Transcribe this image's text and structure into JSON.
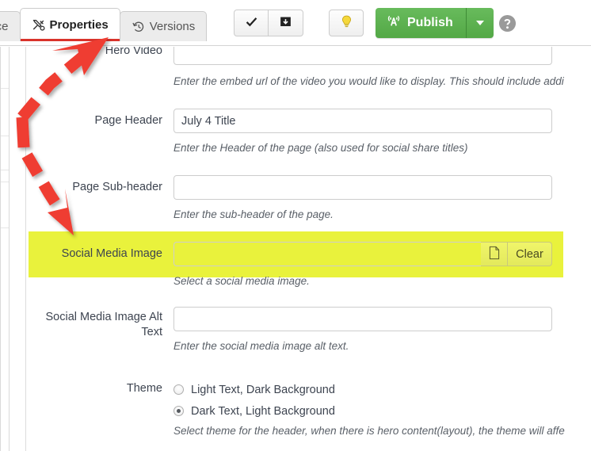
{
  "toolbar": {
    "tabs": [
      {
        "label": "ource",
        "icon": "source-icon",
        "active": false,
        "truncated": true
      },
      {
        "label": "Properties",
        "icon": "tools-icon",
        "active": true
      },
      {
        "label": "Versions",
        "icon": "history-clock-icon",
        "active": false
      }
    ],
    "buttons": [
      {
        "name": "approve-button",
        "icon": "checkmark-icon"
      },
      {
        "name": "save-button",
        "icon": "save-box-down-arrow-icon"
      },
      {
        "name": "tips-button",
        "icon": "lightbulb-icon"
      }
    ],
    "publish_label": "Publish",
    "publish_icon": "broadcast-antenna-icon",
    "publish_color": "#55a847",
    "help_icon": "question-mark-circle-icon"
  },
  "form": {
    "fields": [
      {
        "label": "Hero Video",
        "value": "",
        "hint": "Enter the embed url of the video you would like to display. This should include addi",
        "type": "text",
        "name": "hero-video"
      },
      {
        "label": "Page Header",
        "value": "July 4 Title",
        "hint": "Enter the Header of the page (also used for social share titles)",
        "type": "text",
        "name": "page-header"
      },
      {
        "label": "Page Sub-header",
        "value": "",
        "hint": "Enter the sub-header of the page.",
        "type": "text",
        "name": "page-sub-header"
      },
      {
        "label": "Social Media Image",
        "value": "",
        "hint": "Select a social media image.",
        "type": "picker",
        "name": "social-media-image",
        "highlighted": true,
        "file_icon": "document-page-icon",
        "clear_label": "Clear"
      },
      {
        "label": "Social Media Image Alt Text",
        "value": "",
        "hint": "Enter the social media image alt text.",
        "type": "text",
        "name": "social-media-image-alt-text"
      }
    ],
    "theme": {
      "label": "Theme",
      "options": [
        {
          "label": "Light Text, Dark Background",
          "selected": false
        },
        {
          "label": "Dark Text, Light Background",
          "selected": true
        }
      ],
      "hint": "Select theme for the header, when there is hero content(layout), the theme will affe"
    }
  },
  "annotation": {
    "type": "double-headed-dashed-arrow",
    "color": "#ef3e33",
    "description": "Red dashed arrow pointing up to the Properties tab and down to the Social Media Image row"
  },
  "highlight": {
    "color": "#e9f23c"
  }
}
